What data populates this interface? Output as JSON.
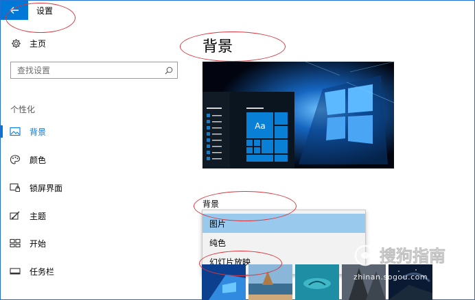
{
  "window": {
    "title": "设置"
  },
  "sidebar": {
    "home_label": "主页",
    "search_placeholder": "查找设置",
    "section_label": "个性化",
    "items": [
      {
        "label": "背景",
        "icon": "picture-icon",
        "active": true
      },
      {
        "label": "颜色",
        "icon": "palette-icon",
        "active": false
      },
      {
        "label": "锁屏界面",
        "icon": "lockscreen-icon",
        "active": false
      },
      {
        "label": "主题",
        "icon": "theme-brush-icon",
        "active": false
      },
      {
        "label": "开始",
        "icon": "start-tiles-icon",
        "active": false
      },
      {
        "label": "任务栏",
        "icon": "taskbar-icon",
        "active": false
      }
    ]
  },
  "main": {
    "page_title": "背景",
    "preview": {
      "tile_text": "Aa"
    },
    "background_label": "背景",
    "dropdown": {
      "options": [
        "图片",
        "纯色",
        "幻灯片放映"
      ],
      "selected": "图片"
    }
  },
  "watermark": {
    "text": "zhinan.sogou.com",
    "logo_text": "搜狗指南"
  },
  "colors": {
    "accent": "#0078d7",
    "annotation": "#d9363e",
    "selected_option": "#99c9ec"
  }
}
